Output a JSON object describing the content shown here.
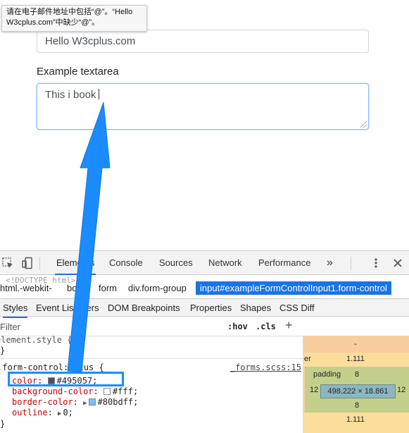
{
  "tooltip": {
    "line1": "请在电子邮件地址中包括“@”。“Hello",
    "line2": "W3cplus.com”中缺少“@”。"
  },
  "form": {
    "email_value": "Hello W3cplus.com",
    "textarea_label": "Example textarea",
    "textarea_value": "This i book"
  },
  "devtools": {
    "tabs": [
      "Elements",
      "Console",
      "Sources",
      "Network",
      "Performance",
      "»"
    ],
    "doctype_ghost": "<!DOCTYPE html>",
    "breadcrumbs": [
      "html.-webkit-",
      "body",
      "form",
      "div.form-group",
      "input#exampleFormControlInput1.form-control"
    ],
    "subtabs": [
      "Styles",
      "Event Listeners",
      "DOM Breakpoints",
      "Properties",
      "Shapes",
      "CSS Diff"
    ],
    "filter_placeholder": "Filter",
    "hov": ":hov",
    "cls": ".cls",
    "plus": "+",
    "styles": {
      "element_style": "element.style {",
      "close1": "}",
      "selector": ".form-control:focus {",
      "source": "_forms.scss:15",
      "decl_color_prop": "color",
      "decl_color_val": "#495057;",
      "decl_bg_prop": "background-color",
      "decl_bg_val": "#fff;",
      "decl_border_prop": "border-color",
      "decl_border_val": "#80bdff;",
      "decl_outline_prop": "outline",
      "decl_outline_val": "0;",
      "close2": "}"
    },
    "swatch_colors": {
      "color": "#495057",
      "background": "#ffffff",
      "border": "#80bdff"
    },
    "box_model": {
      "margin_top": "-",
      "border_label": "er",
      "border_top": "1.111",
      "padding_label": "padding",
      "padding_top": "8",
      "padding_left": "12",
      "padding_right": "12",
      "padding_bottom": "8",
      "content": "498.222 × 18.861",
      "border_bottom": "1.111"
    }
  },
  "colors": {
    "focus_border": "#80bdff",
    "accent": "#1a73e8",
    "annotation_arrow": "#1a8cff"
  }
}
